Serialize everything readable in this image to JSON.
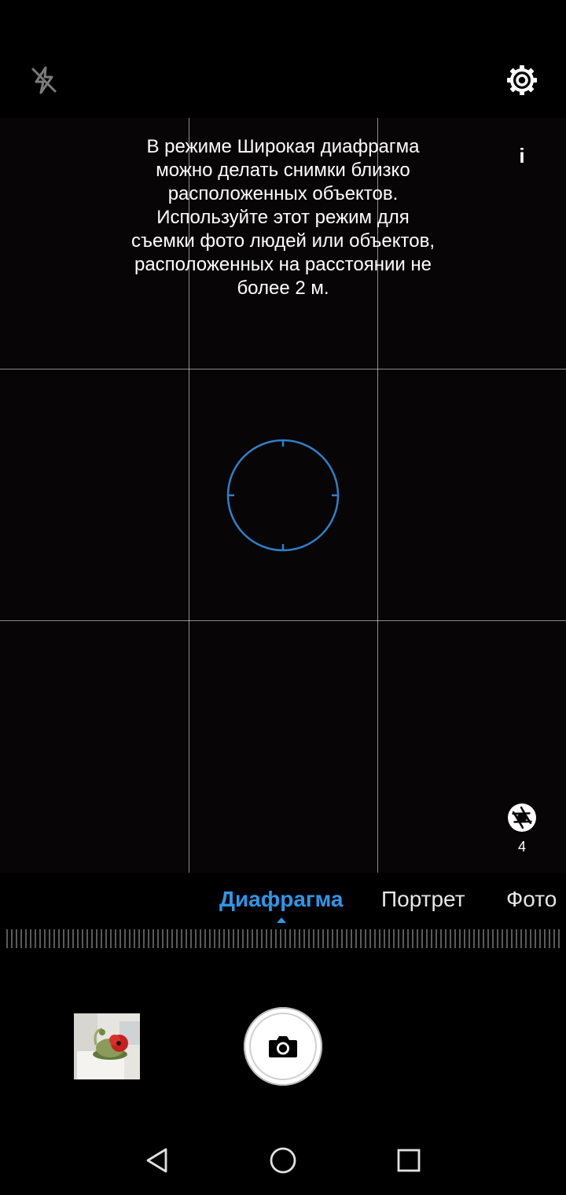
{
  "top_bar": {
    "flash_icon": "flash-off-icon",
    "settings_icon": "gear-icon"
  },
  "viewfinder": {
    "hint_text": "В режиме Широкая диафрагма\nможно делать снимки близко\nрасположенных объектов.\nИспользуйте этот режим для\nсъемки фото людей или объектов,\nрасположенных на расстоянии не\nболее 2 м.",
    "info_label": "i",
    "focus_ring_color": "#2f7fc8",
    "aperture": {
      "icon": "aperture-icon",
      "value": "4"
    }
  },
  "modes": {
    "items": [
      {
        "label": "Диафрагма",
        "active": true
      },
      {
        "label": "Портрет",
        "active": false
      },
      {
        "label": "Фото",
        "active": false
      }
    ],
    "accent_color": "#2f96e8"
  },
  "controls": {
    "gallery_icon": "gallery-thumbnail",
    "shutter_icon": "camera-icon"
  },
  "nav_bar": {
    "back_icon": "back-triangle-icon",
    "home_icon": "home-circle-icon",
    "recents_icon": "recents-square-icon"
  }
}
